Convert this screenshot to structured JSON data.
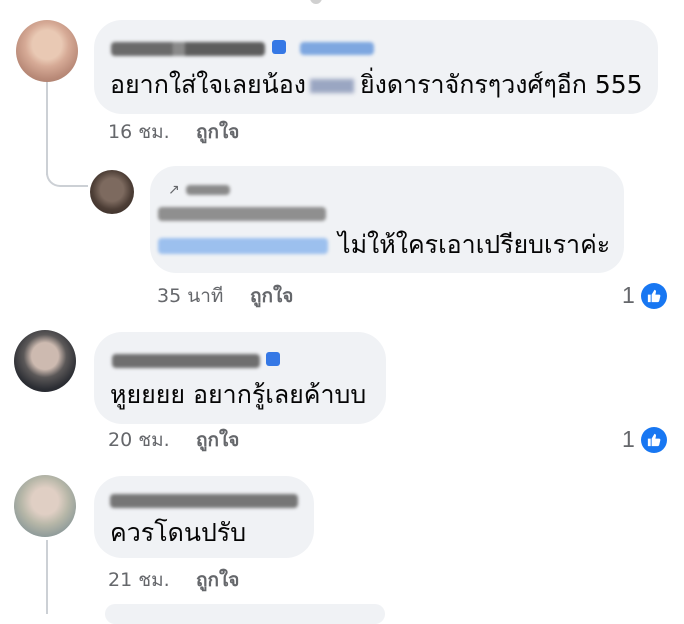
{
  "comments": [
    {
      "text": "อยากใส่ใจเลยน้อง",
      "text_tail": "ยิ่งดาราจักรๆวงศ์ๆอีก 555",
      "time": "16 ชม.",
      "like": "ถูกใจ"
    },
    {
      "reply_label": "ผู้เขียน",
      "text": "ไม่ให้ใครเอาเปรียบเราค่ะ",
      "time": "35 นาที",
      "like": "ถูกใจ",
      "reactions": "1"
    },
    {
      "text": "หูยยยย อยากรู้เลยค้าบบ",
      "time": "20 ชม.",
      "like": "ถูกใจ",
      "reactions": "1"
    },
    {
      "text": "ควรโดนปรับ",
      "time": "21 ชม.",
      "like": "ถูกใจ"
    }
  ],
  "colors": {
    "bubble": "#f0f2f5",
    "like_blue": "#1877f2",
    "meta_gray": "#65676b",
    "link_blue": "#3a8ee6"
  },
  "icons": [
    "avatar",
    "verified-badge-icon",
    "reply-arrow-icon",
    "like-thumb-icon"
  ]
}
